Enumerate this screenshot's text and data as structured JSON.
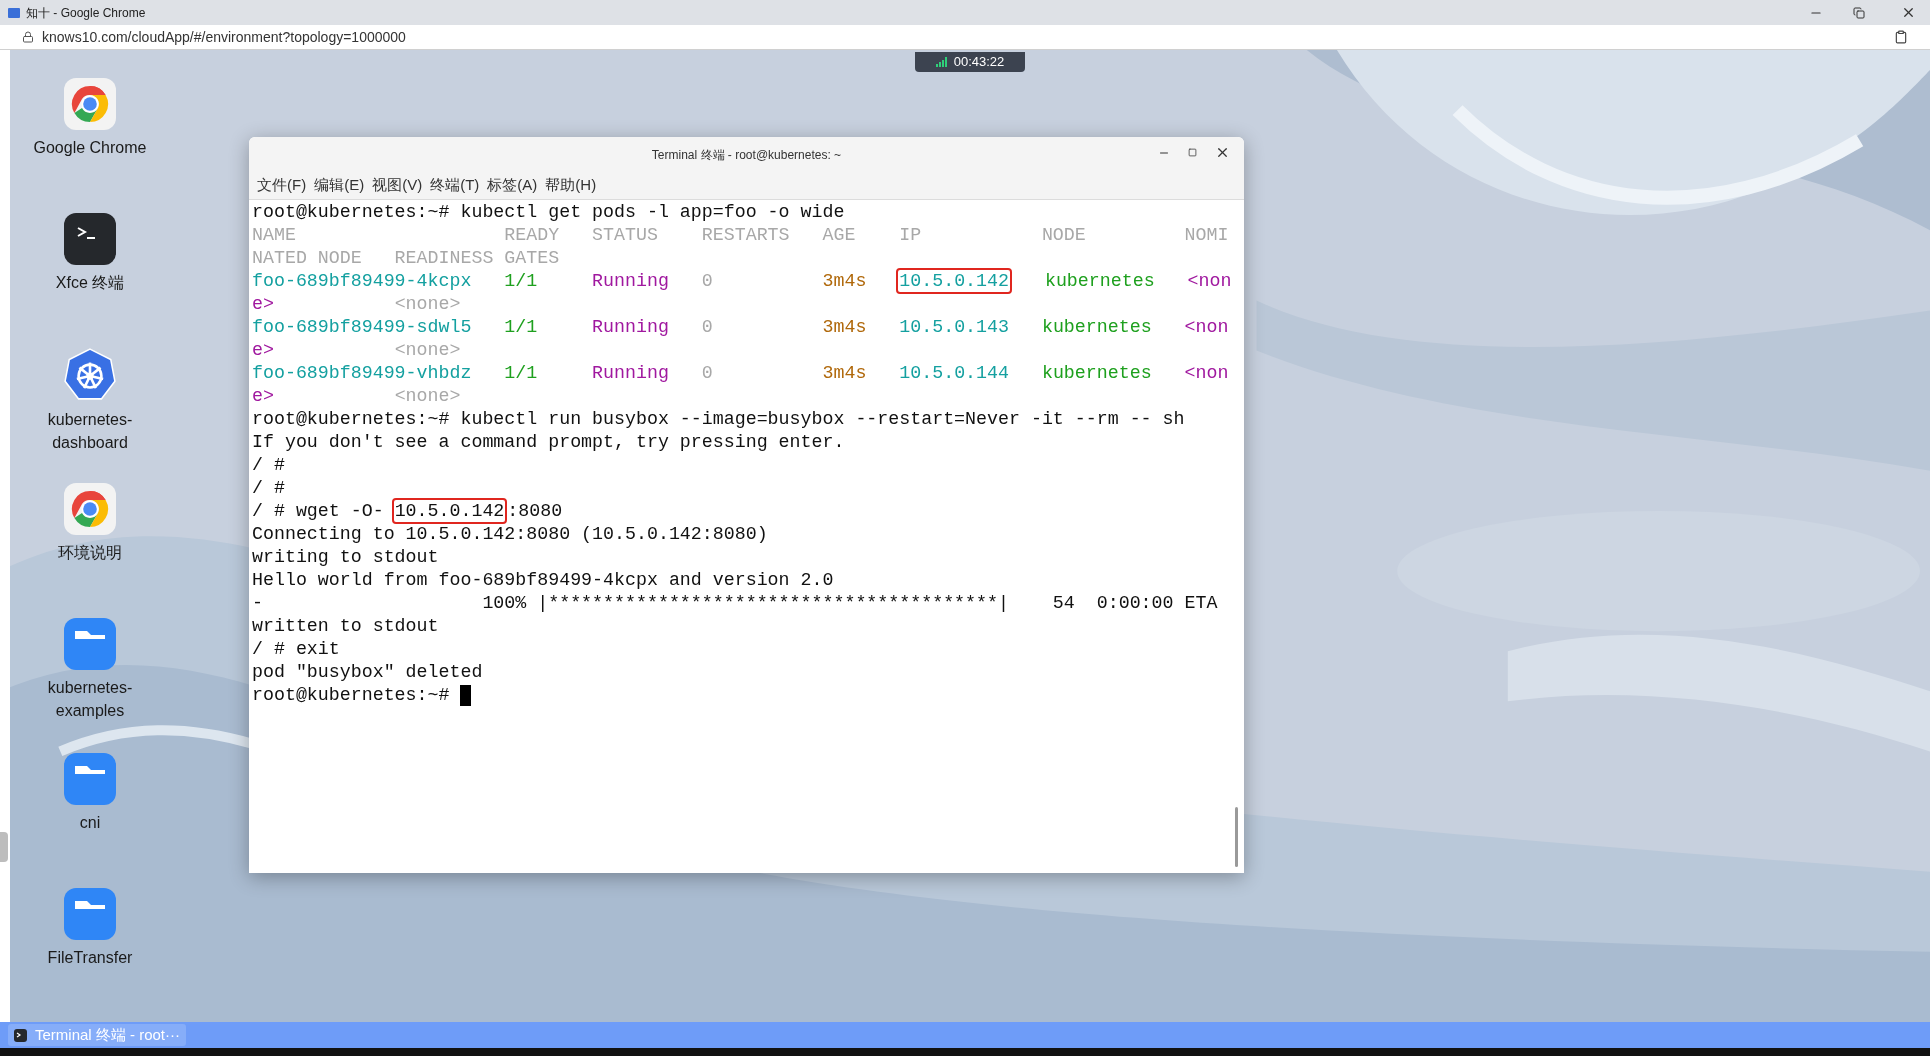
{
  "browser": {
    "title": "知十 - Google Chrome",
    "url": "knows10.com/cloudApp/#/environment?topology=1000000"
  },
  "session_timer": "00:43:22",
  "desktop_icons": [
    {
      "label": "Google Chrome",
      "kind": "chrome"
    },
    {
      "label": "Xfce 终端",
      "kind": "terminal"
    },
    {
      "label": "kubernetes-dashboard",
      "kind": "kubernetes"
    },
    {
      "label": "环境说明",
      "kind": "chrome"
    },
    {
      "label": "kubernetes-examples",
      "kind": "folder"
    },
    {
      "label": "cni",
      "kind": "folder"
    },
    {
      "label": "FileTransfer",
      "kind": "folder"
    }
  ],
  "terminal": {
    "title": "Terminal 终端 - root@kubernetes: ~",
    "menu": [
      "文件(F)",
      "编辑(E)",
      "视图(V)",
      "终端(T)",
      "标签(A)",
      "帮助(H)"
    ],
    "lines": [
      [
        {
          "text": "root@kubernetes:~# kubectl get pods -l app=foo -o wide"
        }
      ],
      [
        {
          "text": "NAME                   READY   STATUS    RESTARTS   AGE    IP           NODE         NOMI",
          "color": "#a8a8a8"
        }
      ],
      [
        {
          "text": "NATED NODE   READINESS GATES",
          "color": "#a8a8a8"
        }
      ],
      [
        {
          "text": "foo-689bf89499-4kcpx   ",
          "color": "#14a0a0"
        },
        {
          "text": "1/1     ",
          "color": "#1ea01e"
        },
        {
          "text": "Running   ",
          "color": "#a0189f"
        },
        {
          "text": "0          ",
          "color": "#a8a8a8"
        },
        {
          "text": "3m4s   ",
          "color": "#b0680a"
        },
        {
          "text": "10.5.0.142",
          "color": "#14a0a0",
          "highlighted": true
        },
        {
          "text": "   kubernetes   ",
          "color": "#1ea01e"
        },
        {
          "text": "<non",
          "color": "#a0189f"
        }
      ],
      [
        {
          "text": "e>           ",
          "color": "#a0189f"
        },
        {
          "text": "<none>",
          "color": "#a8a8a8"
        }
      ],
      [
        {
          "text": "foo-689bf89499-sdwl5   ",
          "color": "#14a0a0"
        },
        {
          "text": "1/1     ",
          "color": "#1ea01e"
        },
        {
          "text": "Running   ",
          "color": "#a0189f"
        },
        {
          "text": "0          ",
          "color": "#a8a8a8"
        },
        {
          "text": "3m4s   ",
          "color": "#b0680a"
        },
        {
          "text": "10.5.0.143",
          "color": "#14a0a0",
          "highlighted": false
        },
        {
          "text": "   kubernetes   ",
          "color": "#1ea01e"
        },
        {
          "text": "<non",
          "color": "#a0189f"
        }
      ],
      [
        {
          "text": "e>           ",
          "color": "#a0189f"
        },
        {
          "text": "<none>",
          "color": "#a8a8a8"
        }
      ],
      [
        {
          "text": "foo-689bf89499-vhbdz   ",
          "color": "#14a0a0"
        },
        {
          "text": "1/1     ",
          "color": "#1ea01e"
        },
        {
          "text": "Running   ",
          "color": "#a0189f"
        },
        {
          "text": "0          ",
          "color": "#a8a8a8"
        },
        {
          "text": "3m4s   ",
          "color": "#b0680a"
        },
        {
          "text": "10.5.0.144",
          "color": "#14a0a0",
          "highlighted": false
        },
        {
          "text": "   kubernetes   ",
          "color": "#1ea01e"
        },
        {
          "text": "<non",
          "color": "#a0189f"
        }
      ],
      [
        {
          "text": "e>           ",
          "color": "#a0189f"
        },
        {
          "text": "<none>",
          "color": "#a8a8a8"
        }
      ],
      [
        {
          "text": "root@kubernetes:~# kubectl run busybox --image=busybox --restart=Never -it --rm -- sh"
        }
      ],
      [
        {
          "text": "If you don't see a command prompt, try pressing enter."
        }
      ],
      [
        {
          "text": "/ #"
        }
      ],
      [
        {
          "text": "/ #"
        }
      ],
      [
        {
          "text": "/ # wget -O- "
        },
        {
          "text": "10.5.0.142",
          "highlighted": true
        },
        {
          "text": ":8080"
        }
      ],
      [
        {
          "text": "Connecting to 10.5.0.142:8080 (10.5.0.142:8080)"
        }
      ],
      [
        {
          "text": "writing to stdout"
        }
      ],
      [
        {
          "text": "Hello world from foo-689bf89499-4kcpx and version 2.0"
        }
      ],
      [
        {
          "text": "-                    100% |*****************************************|    54  0:00:00 ETA"
        }
      ],
      [
        {
          "text": "written to stdout"
        }
      ],
      [
        {
          "text": "/ # exit"
        }
      ],
      [
        {
          "text": "pod \"busybox\" deleted"
        }
      ],
      [
        {
          "text": "root@kubernetes:~# "
        },
        {
          "kind": "cursor"
        }
      ]
    ]
  },
  "taskbar": {
    "items": [
      {
        "label": "Terminal 终端 - root···",
        "selected": true
      }
    ]
  }
}
